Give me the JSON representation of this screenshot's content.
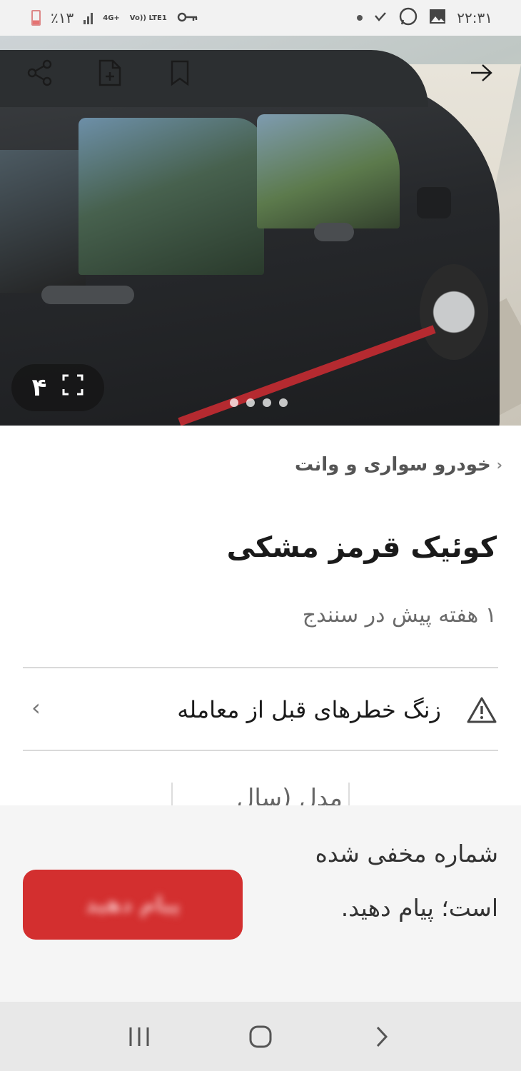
{
  "status_bar": {
    "battery_text": "٪۱۳",
    "network_top": "4G+",
    "network_bottom": "Vo)) LTE1",
    "time": "۲۲:۳۱"
  },
  "hero": {
    "photo_count": "۴",
    "page_indicator": {
      "total": 4,
      "active": 1
    }
  },
  "listing": {
    "breadcrumb": "خودرو سواری و وانت",
    "title": "کوئیک قرمز مشکی",
    "subtitle": "۱ هفته پیش در سنندج",
    "warning": "زنگ خطرهای قبل از معامله",
    "spec_partial": "مدل (سال"
  },
  "contact": {
    "message": "شماره مخفی شده است؛ پیام دهید.",
    "chat_button": "پیام دهید"
  },
  "colors": {
    "accent_red": "#d32f2f",
    "contact_bg": "#f5f5f5",
    "nav_bg": "#e8e8e8"
  }
}
